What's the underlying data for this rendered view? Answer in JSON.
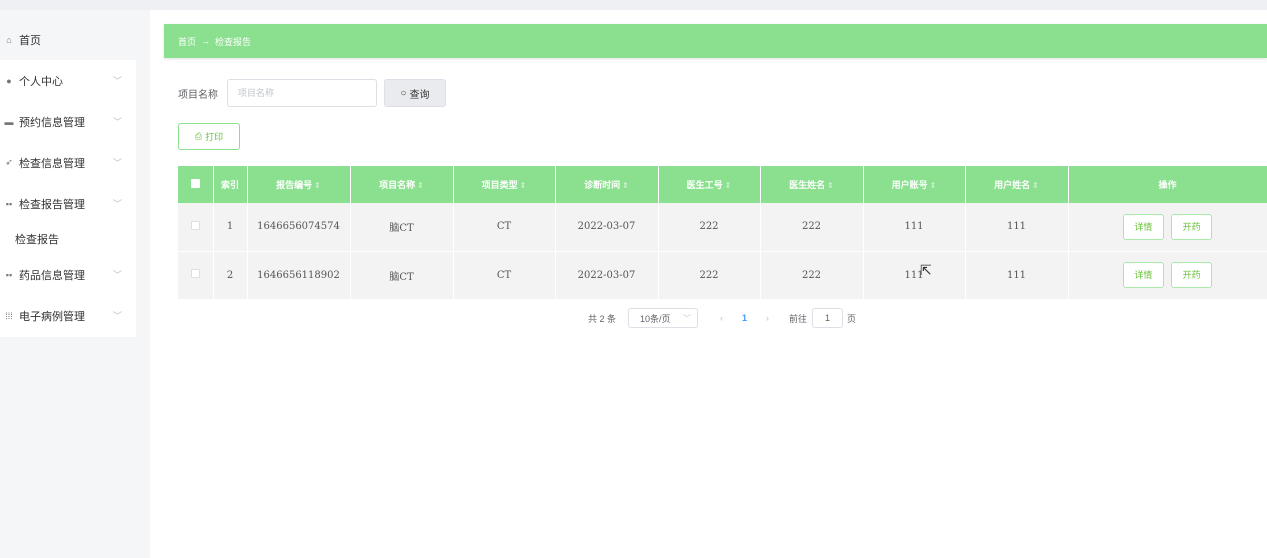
{
  "sidebar": {
    "items": [
      {
        "label": "首页",
        "icon": "home-icon",
        "glyph": "⌂"
      },
      {
        "label": "个人中心",
        "icon": "user-icon",
        "glyph": "●",
        "chevron": "﹀"
      },
      {
        "label": "预约信息管理",
        "icon": "calendar-icon",
        "glyph": "▬",
        "chevron": "﹀"
      },
      {
        "label": "检查信息管理",
        "icon": "send-icon",
        "glyph": "➶",
        "chevron": "﹀"
      },
      {
        "label": "检查报告管理",
        "icon": "grid-icon",
        "glyph": "▪▪",
        "chevron": "﹀"
      },
      {
        "label": "药品信息管理",
        "icon": "grid-icon",
        "glyph": "▪▪",
        "chevron": "﹀"
      },
      {
        "label": "电子病例管理",
        "icon": "apps-icon",
        "glyph": "⁞⁞⁞",
        "chevron": "﹀"
      }
    ],
    "sub_item": "检查报告"
  },
  "breadcrumb": {
    "home": "首页",
    "arrow": "→",
    "current": "检查报告"
  },
  "search": {
    "label": "项目名称",
    "placeholder": "项目名称",
    "button": "查询",
    "button_icon": "○"
  },
  "toolbar": {
    "print": "打印",
    "print_icon": "⎙"
  },
  "table": {
    "columns": [
      "索引",
      "报告编号",
      "项目名称",
      "项目类型",
      "诊断时间",
      "医生工号",
      "医生姓名",
      "用户账号",
      "用户姓名",
      "操作"
    ],
    "sort_glyph": "⇕",
    "rows": [
      {
        "index": "1",
        "report_no": "1646656074574",
        "item_name": "脑CT",
        "item_type": "CT",
        "time": "2022-03-07",
        "doctor_id": "222",
        "doctor_name": "222",
        "user_account": "111",
        "user_name": "111"
      },
      {
        "index": "2",
        "report_no": "1646656118902",
        "item_name": "脑CT",
        "item_type": "CT",
        "time": "2022-03-07",
        "doctor_id": "222",
        "doctor_name": "222",
        "user_account": "111",
        "user_name": "111"
      }
    ],
    "detail_label": "详情",
    "prescribe_label": "开药"
  },
  "pagination": {
    "total": "共 2 条",
    "page_size": "10条/页",
    "prev": "‹",
    "current": "1",
    "next": "›",
    "goto_label": "前往",
    "goto_value": "1",
    "unit": "页"
  },
  "colors": {
    "accent": "#8ae08e",
    "button_text": "#67c23a",
    "active_page": "#409eff"
  }
}
